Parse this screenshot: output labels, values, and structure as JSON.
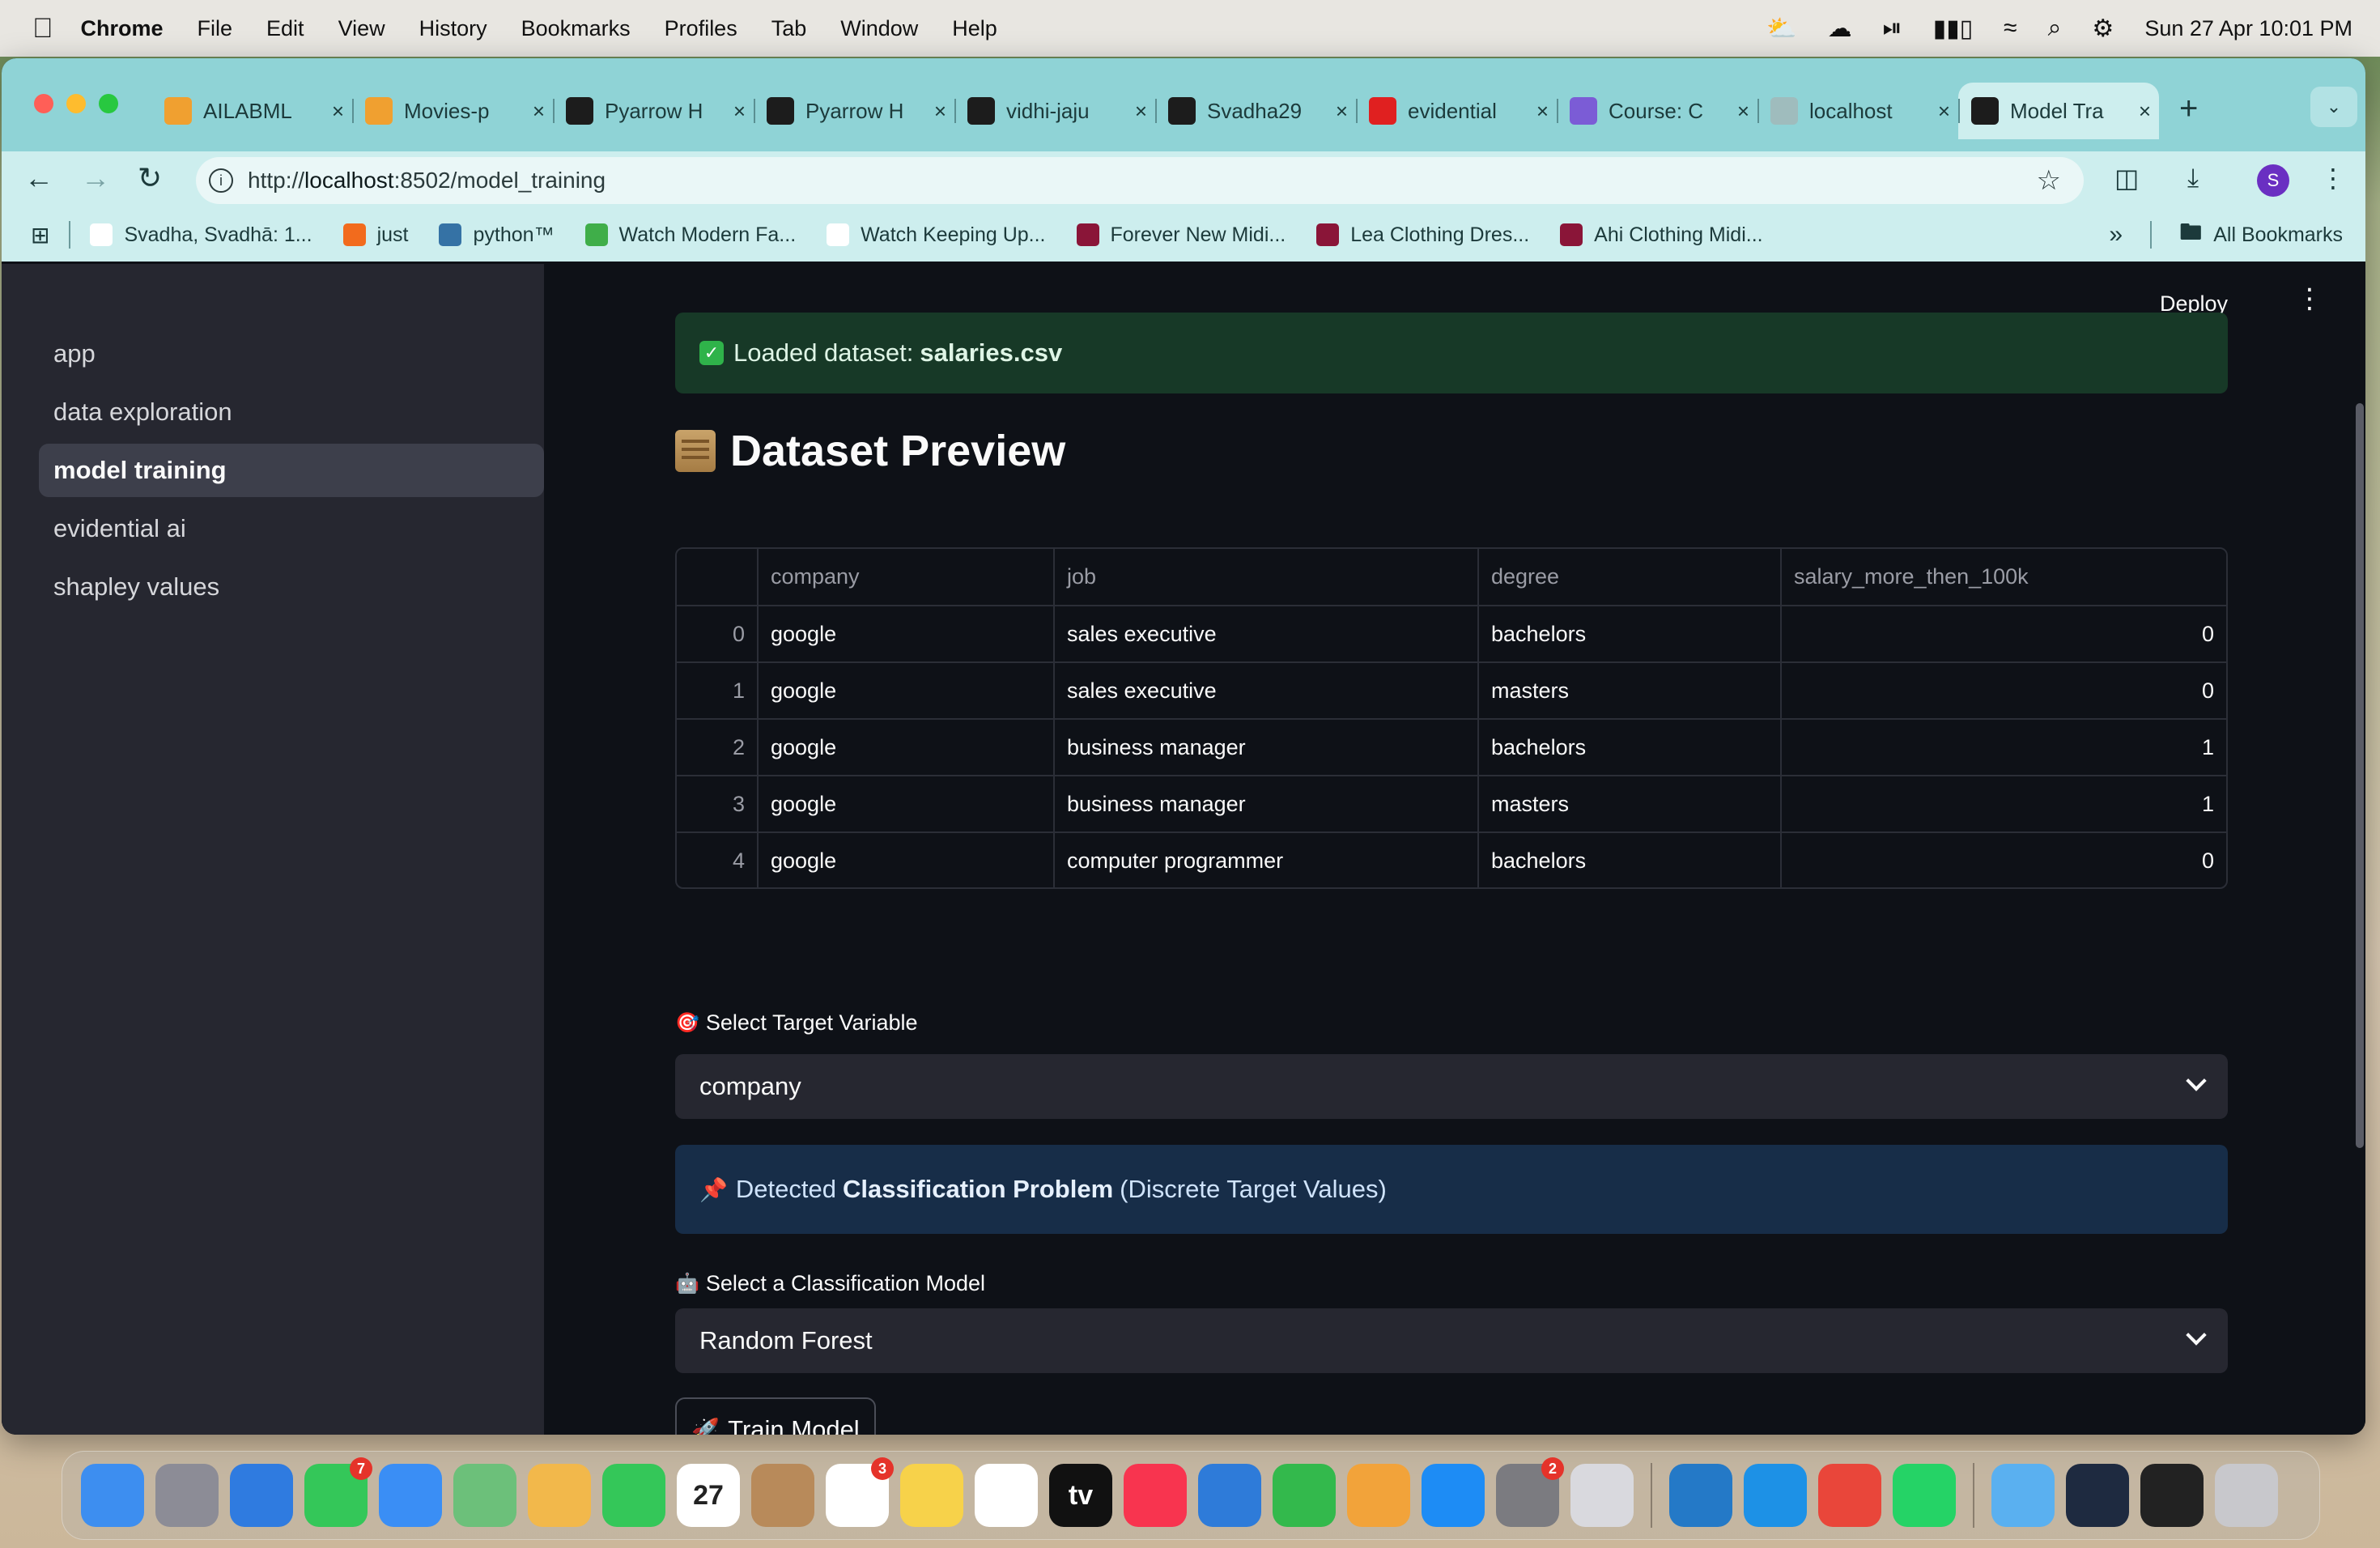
{
  "menubar": {
    "app_name": "Chrome",
    "menus": [
      "File",
      "Edit",
      "View",
      "History",
      "Bookmarks",
      "Profiles",
      "Tab",
      "Window",
      "Help"
    ],
    "clock": "Sun 27 Apr  10:01 PM"
  },
  "browser": {
    "tabs": [
      {
        "title": "AILABML",
        "icon": "ailab-icon",
        "color": "#f0a030"
      },
      {
        "title": "Movies-p",
        "icon": "ailab-icon",
        "color": "#f0a030"
      },
      {
        "title": "Pyarrow H",
        "icon": "openai-icon",
        "color": "#1c1c1c"
      },
      {
        "title": "Pyarrow H",
        "icon": "openai-icon",
        "color": "#1c1c1c"
      },
      {
        "title": "vidhi-jaju",
        "icon": "github-icon",
        "color": "#1c1c1c"
      },
      {
        "title": "Svadha29",
        "icon": "github-icon",
        "color": "#1c1c1c"
      },
      {
        "title": "evidential",
        "icon": "youtube-icon",
        "color": "#e02020"
      },
      {
        "title": "Course: C",
        "icon": "course-icon",
        "color": "#7b5cd6"
      },
      {
        "title": "localhost",
        "icon": "loading-icon",
        "color": "#9fbcbd"
      },
      {
        "title": "Model Tra",
        "icon": "streamlit-icon",
        "color": "#1c1c1c"
      }
    ],
    "url_prefix": "http://",
    "url_host": "localhost",
    "url_rest": ":8502/model_training",
    "bookmarks": [
      {
        "label": "Svadha, Svadhā: 1...",
        "color": "#ffffff"
      },
      {
        "label": "just",
        "color": "#f26b1d"
      },
      {
        "label": "python™",
        "color": "#3572a5"
      },
      {
        "label": "Watch Modern Fa...",
        "color": "#3fae49"
      },
      {
        "label": "Watch Keeping Up...",
        "color": "#ffffff"
      },
      {
        "label": "Forever New Midi...",
        "color": "#8a1538"
      },
      {
        "label": "Lea Clothing Dres...",
        "color": "#8a1538"
      },
      {
        "label": "Ahi Clothing Midi...",
        "color": "#8a1538"
      }
    ],
    "all_bookmarks": "All Bookmarks"
  },
  "sidebar": {
    "items": [
      {
        "label": "app"
      },
      {
        "label": "data exploration"
      },
      {
        "label": "model training"
      },
      {
        "label": "evidential ai"
      },
      {
        "label": "shapley values"
      }
    ]
  },
  "main": {
    "deploy_label": "Deploy",
    "success_prefix": "Loaded dataset:",
    "success_file": "salaries.csv",
    "preview_title": "Dataset Preview",
    "table": {
      "columns": [
        "company",
        "job",
        "degree",
        "salary_more_then_100k"
      ],
      "rows": [
        {
          "index": "0",
          "company": "google",
          "job": "sales executive",
          "degree": "bachelors",
          "salary": "0"
        },
        {
          "index": "1",
          "company": "google",
          "job": "sales executive",
          "degree": "masters",
          "salary": "0"
        },
        {
          "index": "2",
          "company": "google",
          "job": "business manager",
          "degree": "bachelors",
          "salary": "1"
        },
        {
          "index": "3",
          "company": "google",
          "job": "business manager",
          "degree": "masters",
          "salary": "1"
        },
        {
          "index": "4",
          "company": "google",
          "job": "computer programmer",
          "degree": "bachelors",
          "salary": "0"
        }
      ]
    },
    "target_label": "Select Target Variable",
    "target_value": "company",
    "info_prefix": "Detected",
    "info_bold": "Classification Problem",
    "info_suffix": "(Discrete Target Values)",
    "model_label": "Select a Classification Model",
    "model_value": "Random Forest",
    "train_label": "Train Model"
  },
  "dock": {
    "apps": [
      {
        "name": "finder",
        "color": "#3d8ef0"
      },
      {
        "name": "launchpad",
        "color": "#8c8c96"
      },
      {
        "name": "safari",
        "color": "#2f7be0"
      },
      {
        "name": "messages",
        "color": "#34c759",
        "badge": "7"
      },
      {
        "name": "mail",
        "color": "#3a8ef5"
      },
      {
        "name": "maps",
        "color": "#6cc07a"
      },
      {
        "name": "photos",
        "color": "#f2b84b"
      },
      {
        "name": "facetime",
        "color": "#34c759"
      },
      {
        "name": "calendar",
        "color": "#ffffff",
        "text": "27"
      },
      {
        "name": "contacts",
        "color": "#b88a5a"
      },
      {
        "name": "reminders",
        "color": "#ffffff",
        "badge": "3"
      },
      {
        "name": "notes",
        "color": "#f7d24a"
      },
      {
        "name": "freeform",
        "color": "#ffffff"
      },
      {
        "name": "apple-tv",
        "color": "#111111",
        "text": "tv"
      },
      {
        "name": "music",
        "color": "#f8344f"
      },
      {
        "name": "keynote",
        "color": "#2e7bd9"
      },
      {
        "name": "numbers",
        "color": "#33b94c"
      },
      {
        "name": "pages",
        "color": "#f2a33a"
      },
      {
        "name": "app-store",
        "color": "#1d8cf5"
      },
      {
        "name": "system-settings",
        "color": "#7b7b80",
        "badge": "2"
      },
      {
        "name": "iphone-mirroring",
        "color": "#d9d9de"
      },
      {
        "name": "vscode",
        "color": "#2479c7"
      },
      {
        "name": "docker",
        "color": "#1d91e6"
      },
      {
        "name": "chrome",
        "color": "#e9463a"
      },
      {
        "name": "whatsapp",
        "color": "#25d366"
      },
      {
        "name": "folder",
        "color": "#5ab0f0"
      },
      {
        "name": "screen-window",
        "color": "#1e2a40"
      },
      {
        "name": "terminal-window",
        "color": "#222222"
      },
      {
        "name": "trash",
        "color": "#c8c8cc"
      }
    ]
  }
}
